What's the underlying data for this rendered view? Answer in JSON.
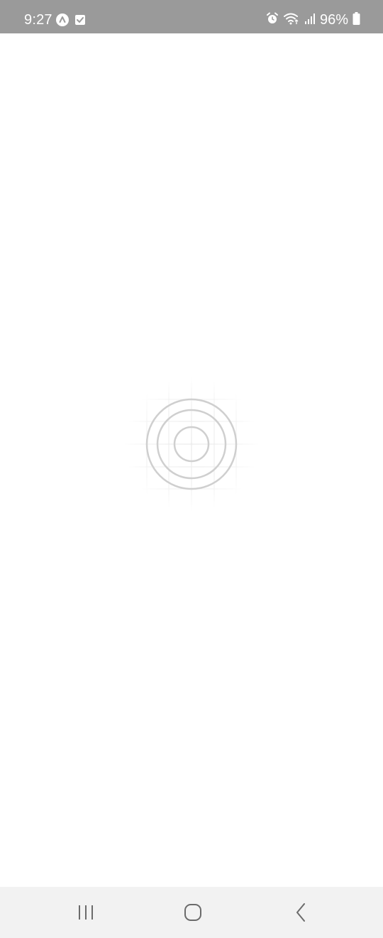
{
  "status_bar": {
    "time": "9:27",
    "battery_text": "96%",
    "left_icons": [
      "auto-sync-icon",
      "task-check-icon"
    ],
    "right_icons": [
      "alarm-icon",
      "wifi-icon",
      "signal-icon",
      "battery-icon"
    ]
  },
  "loader": {
    "icon": "target-rings-icon"
  },
  "nav_bar": {
    "buttons": [
      "recents-icon",
      "home-icon",
      "back-icon"
    ]
  },
  "colors": {
    "status_bar_bg": "#9a9a9a",
    "nav_bar_bg": "#f2f2f2",
    "loader_stroke": "#cfcfcf"
  }
}
